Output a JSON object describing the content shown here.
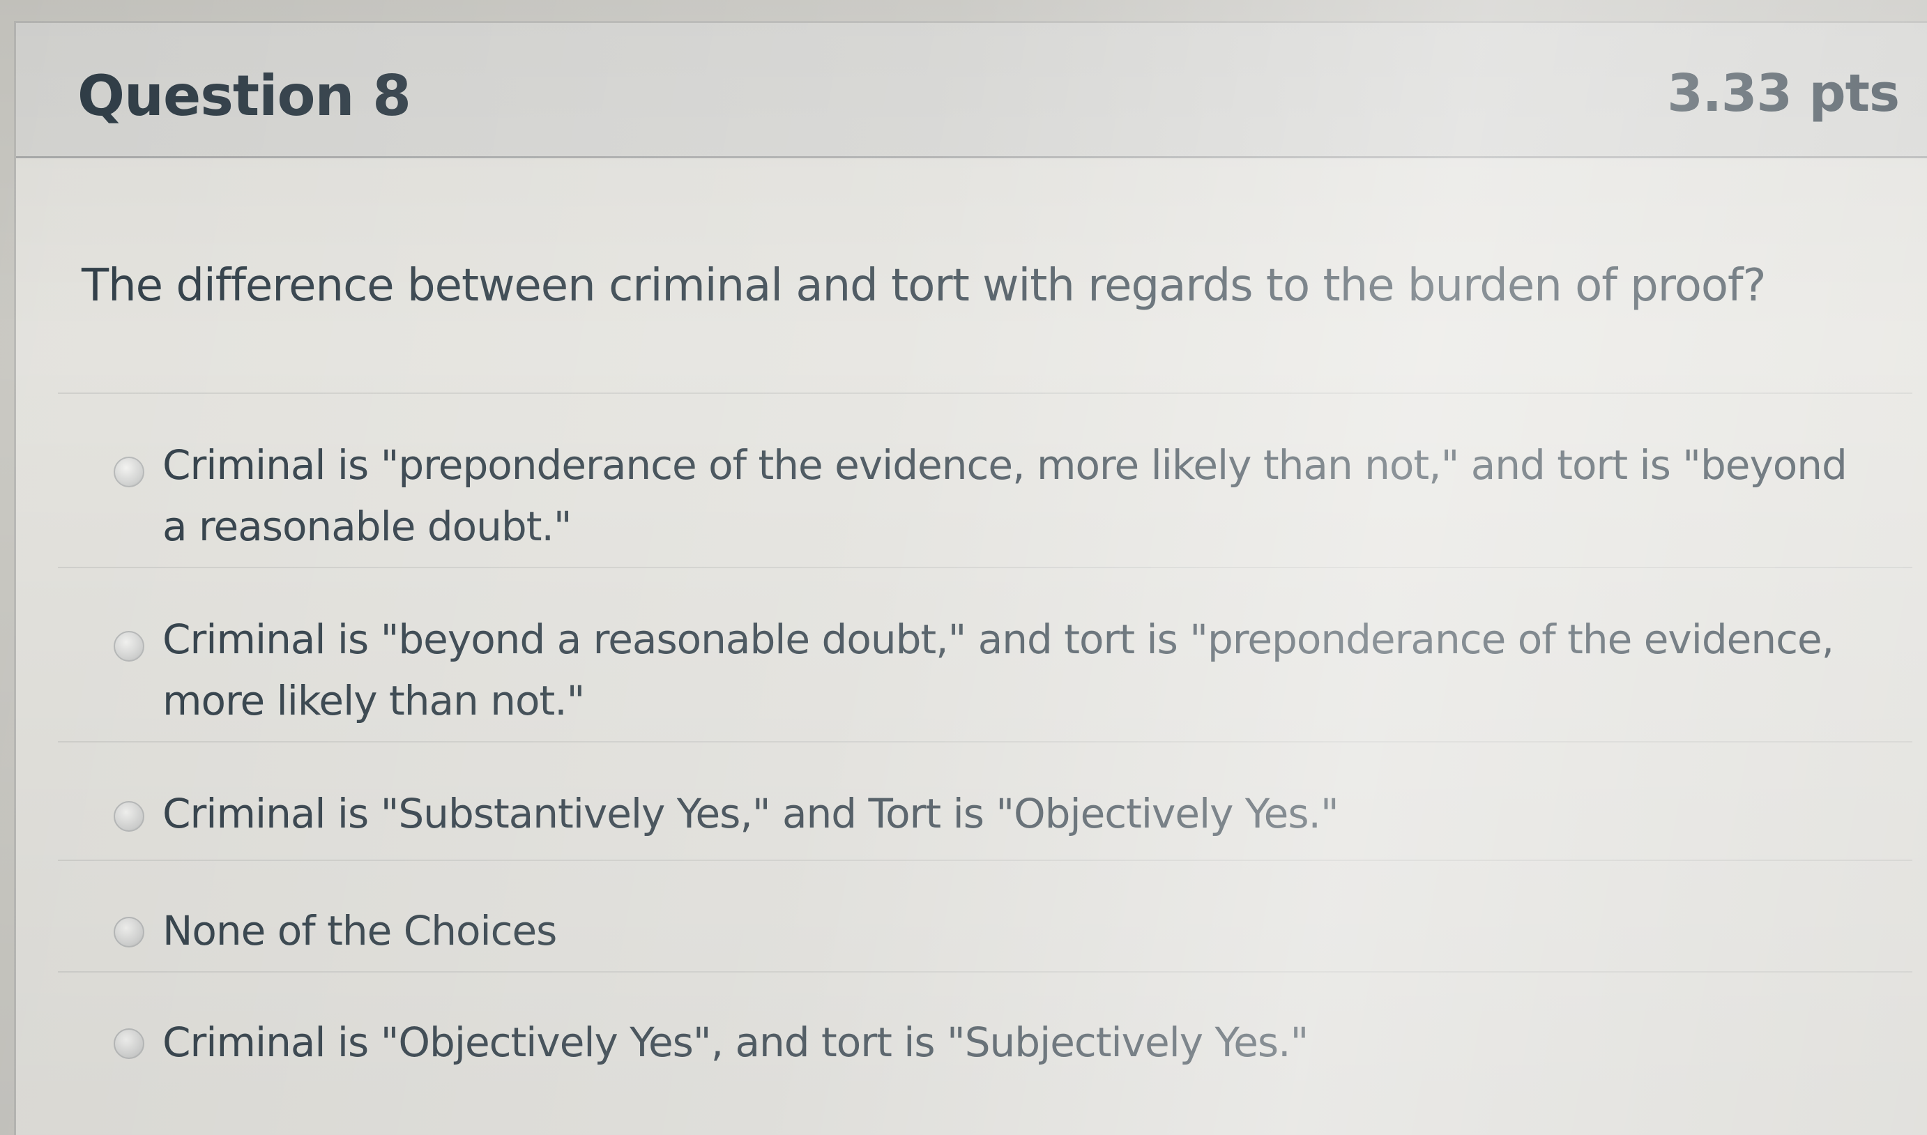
{
  "question": {
    "title": "Question 8",
    "points": "3.33 pts",
    "prompt": "The difference between criminal and tort with regards to the burden of proof?",
    "answers": [
      {
        "label": "Criminal is \"preponderance of the evidence, more likely than not,\" and tort is \"beyond a reasonable doubt.\"",
        "selected": false
      },
      {
        "label": "Criminal is \"beyond a reasonable doubt,\" and tort is \"preponderance of the evidence, more likely than not.\"",
        "selected": false
      },
      {
        "label": "Criminal is \"Substantively Yes,\" and Tort is \"Objectively Yes.\"",
        "selected": false
      },
      {
        "label": "None of the Choices",
        "selected": false
      },
      {
        "label": "Criminal is \"Objectively Yes\", and tort is \"Subjectively Yes.\"",
        "selected": false
      }
    ]
  },
  "colors": {
    "text": "#2d3b45",
    "header_background": "#d6d6d3",
    "card_background": "#e3e2dd"
  }
}
